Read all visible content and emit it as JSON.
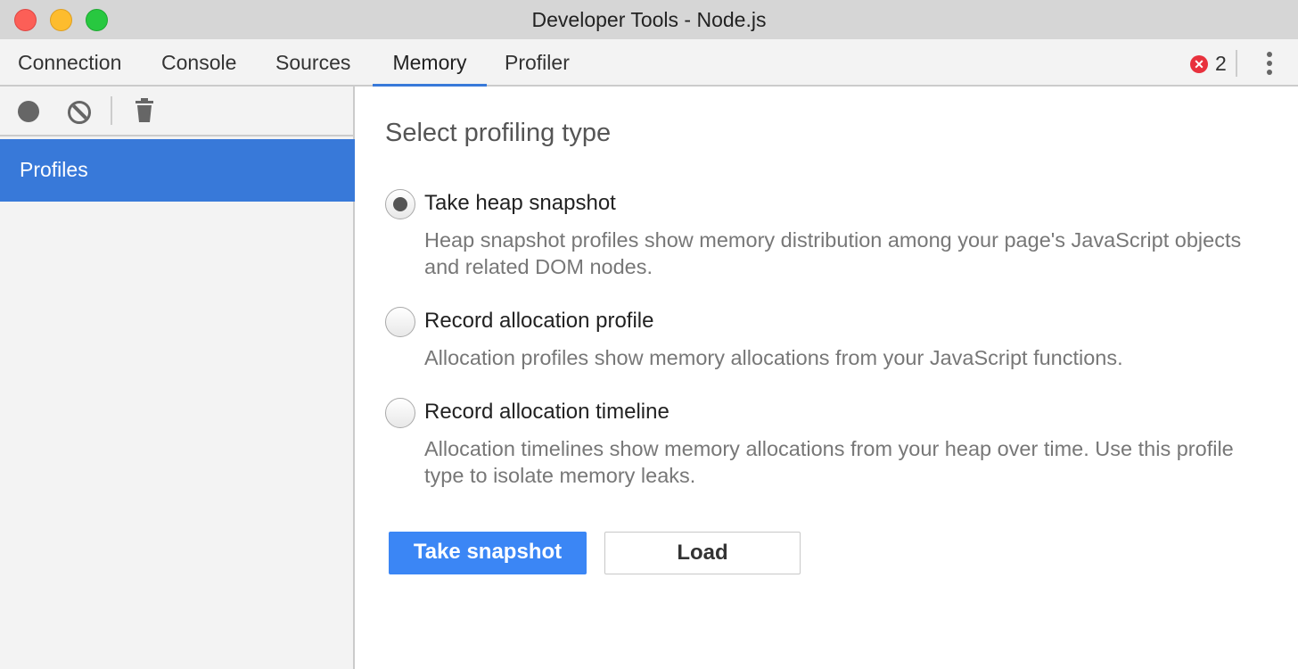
{
  "window": {
    "title": "Developer Tools - Node.js"
  },
  "tabs": [
    {
      "label": "Connection"
    },
    {
      "label": "Console"
    },
    {
      "label": "Sources"
    },
    {
      "label": "Memory"
    },
    {
      "label": "Profiler"
    }
  ],
  "error_count": "2",
  "sidebar": {
    "profiles_label": "Profiles"
  },
  "main": {
    "heading": "Select profiling type",
    "options": [
      {
        "label": "Take heap snapshot",
        "desc": "Heap snapshot profiles show memory distribution among your page's JavaScript objects and related DOM nodes.",
        "selected": true
      },
      {
        "label": "Record allocation profile",
        "desc": "Allocation profiles show memory allocations from your JavaScript functions.",
        "selected": false
      },
      {
        "label": "Record allocation timeline",
        "desc": "Allocation timelines show memory allocations from your heap over time. Use this profile type to isolate memory leaks.",
        "selected": false
      }
    ],
    "take_snapshot": "Take snapshot",
    "load": "Load"
  }
}
